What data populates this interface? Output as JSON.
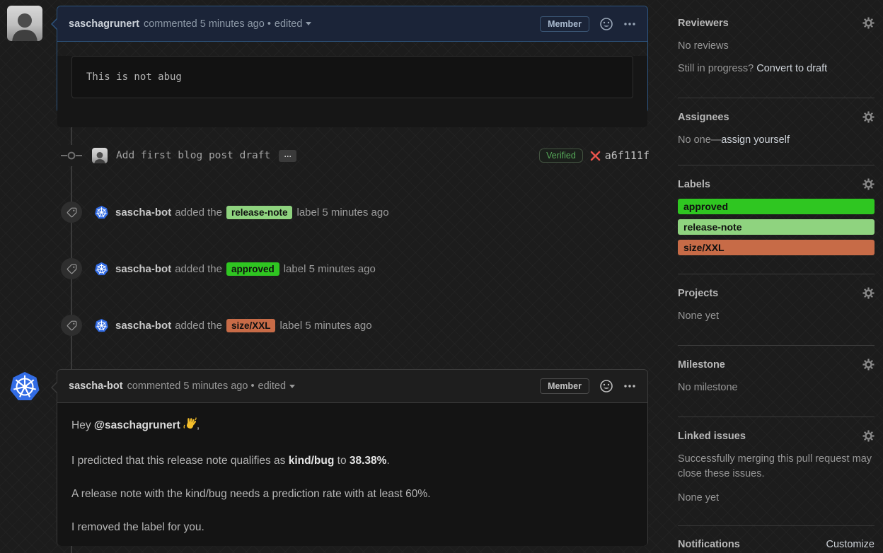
{
  "colors": {
    "author_accent": "#2d547e",
    "k8s_blue": "#326ce5",
    "verified_green": "#57ab5a",
    "error_red": "#e5534b"
  },
  "comment1": {
    "author": "saschagrunert",
    "meta": "commented 5 minutes ago •",
    "edited": "edited",
    "badge": "Member",
    "code": "This is not abug"
  },
  "commit": {
    "message": "Add first blog post draft",
    "expander": "…",
    "verified": "Verified",
    "sha": "a6f111f"
  },
  "events": [
    {
      "actor": "sascha-bot",
      "action": "added the",
      "label": "release-note",
      "suffix": "label 5 minutes ago",
      "label_bg": "#8fd37f"
    },
    {
      "actor": "sascha-bot",
      "action": "added the",
      "label": "approved",
      "suffix": "label 5 minutes ago",
      "label_bg": "#2fc621"
    },
    {
      "actor": "sascha-bot",
      "action": "added the",
      "label": "size/XXL",
      "suffix": "label 5 minutes ago",
      "label_bg": "#c76b47"
    }
  ],
  "comment2": {
    "author": "sascha-bot",
    "meta": "commented 5 minutes ago •",
    "edited": "edited",
    "badge": "Member",
    "p1_prefix": "Hey ",
    "p1_mention": "@saschagrunert",
    "p1_suffix": ",",
    "p2_a": "I predicted that this release note qualifies as ",
    "p2_b": "kind/bug",
    "p2_c": " to ",
    "p2_d": "38.38%",
    "p2_e": ".",
    "p3": "A release note with the kind/bug needs a prediction rate with at least 60%.",
    "p4": "I removed the label for you."
  },
  "sidebar": {
    "reviewers": {
      "title": "Reviewers",
      "empty": "No reviews",
      "hint_prefix": "Still in progress? ",
      "hint_link": "Convert to draft"
    },
    "assignees": {
      "title": "Assignees",
      "empty_prefix": "No one—",
      "empty_link": "assign yourself"
    },
    "labels": {
      "title": "Labels",
      "items": [
        {
          "name": "approved",
          "bg": "#2fc621"
        },
        {
          "name": "release-note",
          "bg": "#8fd37f"
        },
        {
          "name": "size/XXL",
          "bg": "#c76b47"
        }
      ]
    },
    "projects": {
      "title": "Projects",
      "empty": "None yet"
    },
    "milestone": {
      "title": "Milestone",
      "empty": "No milestone"
    },
    "linked_issues": {
      "title": "Linked issues",
      "description": "Successfully merging this pull request may close these issues.",
      "empty": "None yet"
    },
    "notifications": {
      "title": "Notifications",
      "action": "Customize"
    }
  }
}
